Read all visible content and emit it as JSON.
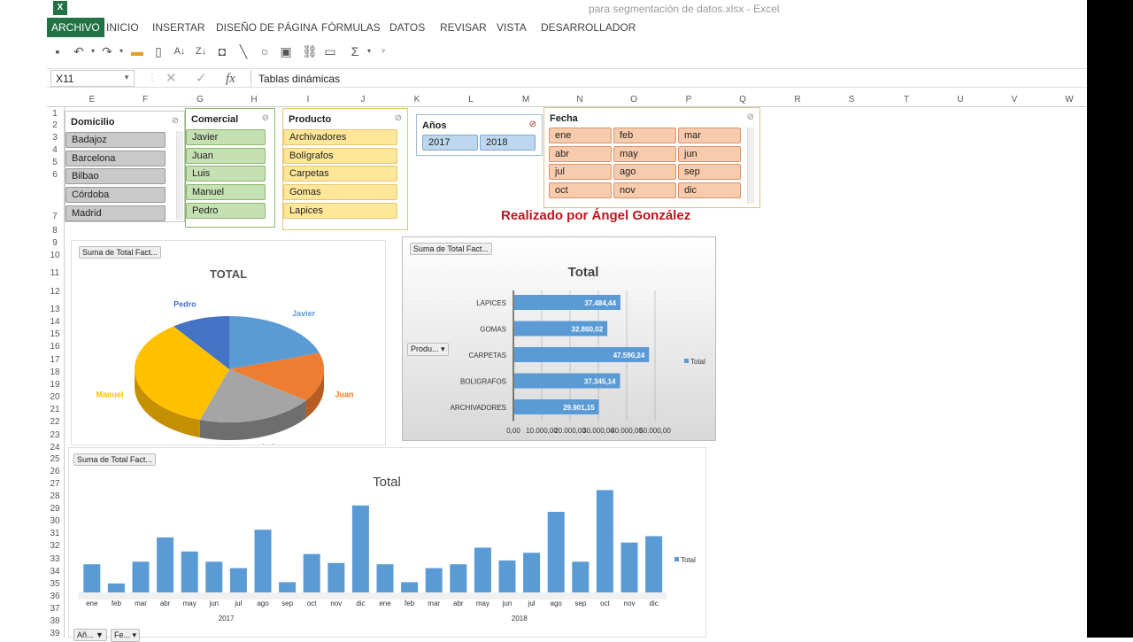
{
  "window": {
    "title": "para segmentación de datos.xlsx - Excel",
    "app_icon": "X"
  },
  "ribbon": {
    "tabs": [
      "ARCHIVO",
      "INICIO",
      "INSERTAR",
      "DISEÑO DE PÁGINA",
      "FÓRMULAS",
      "DATOS",
      "REVISAR",
      "VISTA",
      "DESARROLLADOR"
    ],
    "active": "ARCHIVO"
  },
  "formula_bar": {
    "name_box": "X11",
    "fx": "fx",
    "content": "Tablas dinámicas"
  },
  "columns": [
    "E",
    "F",
    "G",
    "H",
    "I",
    "J",
    "K",
    "L",
    "M",
    "N",
    "O",
    "P",
    "Q",
    "R",
    "S",
    "T",
    "U",
    "V",
    "W"
  ],
  "rows": [
    "1",
    "2",
    "3",
    "4",
    "5",
    "6",
    "7",
    "8",
    "9",
    "10",
    "11",
    "12",
    "13",
    "14",
    "15",
    "16",
    "17",
    "18",
    "19",
    "20",
    "21",
    "22",
    "23",
    "24",
    "25",
    "26",
    "27",
    "28",
    "29",
    "30",
    "31",
    "32",
    "33",
    "34",
    "35",
    "36",
    "37",
    "38",
    "39"
  ],
  "slicers": {
    "domicilio": {
      "title": "Domicilio",
      "items": [
        "Badajoz",
        "Barcelona",
        "Bilbao",
        "Córdoba",
        "Madrid"
      ]
    },
    "comercial": {
      "title": "Comercial",
      "items": [
        "Javier",
        "Juan",
        "Luis",
        "Manuel",
        "Pedro"
      ]
    },
    "producto": {
      "title": "Producto",
      "items": [
        "Archivadores",
        "Bolígrafos",
        "Carpetas",
        "Gomas",
        "Lapices"
      ]
    },
    "anos": {
      "title": "Años",
      "items": [
        "2017",
        "2018"
      ]
    },
    "fecha": {
      "title": "Fecha",
      "items": [
        "ene",
        "feb",
        "mar",
        "abr",
        "may",
        "jun",
        "jul",
        "ago",
        "sep",
        "oct",
        "nov",
        "dic"
      ]
    }
  },
  "credit": "Realizado por Ángel González",
  "colors": {
    "excel_green": "#217346",
    "credit_red": "#c0141c",
    "bar_blue": "#5b9bd5"
  },
  "chart_data": [
    {
      "type": "pie",
      "title": "TOTAL",
      "field_button": "Suma de Total Fact...",
      "slices": [
        {
          "label": "Javier",
          "value": 20,
          "color": "#5b9bd5"
        },
        {
          "label": "Juan",
          "value": 15,
          "color": "#ed7d31"
        },
        {
          "label": "Luis",
          "value": 20,
          "color": "#a5a5a5"
        },
        {
          "label": "Manuel",
          "value": 35,
          "color": "#ffc000"
        },
        {
          "label": "Pedro",
          "value": 10,
          "color": "#4472c4"
        }
      ]
    },
    {
      "type": "bar",
      "title": "Total",
      "field_button": "Suma de Total Fact...",
      "axis_button": "Produ...",
      "legend": "Total",
      "categories": [
        "LAPICES",
        "GOMAS",
        "CARPETAS",
        "BOLIGRAFOS",
        "ARCHIVADORES"
      ],
      "values": [
        37484.44,
        32860.02,
        47590.24,
        37345.14,
        29901.15
      ],
      "value_labels": [
        "37.484,44",
        "32.860,02",
        "47.590,24",
        "37.345,14",
        "29.901,15"
      ],
      "ticks": [
        "0,00",
        "10.000,00",
        "20.000,00",
        "30.000,00",
        "40.000,00",
        "50.000,00"
      ],
      "xlim": [
        0,
        50000
      ]
    },
    {
      "type": "bar",
      "title": "Total",
      "field_button": "Suma de Total Fact...",
      "legend": "Total",
      "filter_buttons": [
        "Añ...",
        "Fe..."
      ],
      "groups": [
        "2017",
        "2018"
      ],
      "categories": [
        "ene",
        "feb",
        "mar",
        "abr",
        "may",
        "jun",
        "jul",
        "ago",
        "sep",
        "oct",
        "nov",
        "dic",
        "ene",
        "feb",
        "mar",
        "abr",
        "may",
        "jun",
        "jul",
        "ago",
        "sep",
        "oct",
        "nov",
        "dic"
      ],
      "values": [
        22,
        7,
        24,
        43,
        32,
        24,
        19,
        49,
        8,
        30,
        23,
        68,
        22,
        8,
        19,
        22,
        35,
        25,
        31,
        63,
        24,
        80,
        39,
        44
      ],
      "ylim": [
        0,
        90
      ]
    }
  ]
}
